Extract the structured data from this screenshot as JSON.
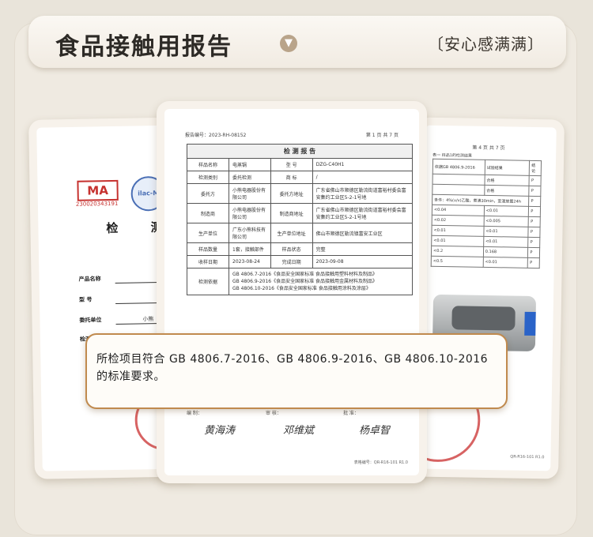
{
  "header": {
    "title": "食品接触用报告",
    "slogan": "〔安心感满满〕"
  },
  "left_cert": {
    "ma_label": "MA",
    "ma_number": "230020343191",
    "ilac_label": "ilac-M",
    "title": "检 测",
    "fields": [
      "产品名称",
      "型 号",
      "委托单位",
      "检测类别"
    ],
    "partial": "小熊"
  },
  "report": {
    "report_no": "报告编号：2023-RH-08152",
    "page": "第 1 页 共 7 页",
    "table_title": "检 测 报 告",
    "rows": [
      {
        "l1": "样品名称",
        "v1": "电蒸锅",
        "l2": "型 号",
        "v2": "DZG-C40H1"
      },
      {
        "l1": "检测类别",
        "v1": "委托检测",
        "l2": "商 标",
        "v2": "/"
      },
      {
        "l1": "委托方",
        "v1": "小熊电器股份有限公司",
        "l2": "委托方地址",
        "v2": "广东省佛山市顺德区勒流街道富裕村委会富安集约工业区5-2-1号地"
      },
      {
        "l1": "制造商",
        "v1": "小熊电器股份有限公司",
        "l2": "制造商地址",
        "v2": "广东省佛山市顺德区勒流街道富裕村委会富安集约工业区5-2-1号地"
      },
      {
        "l1": "生产单位",
        "v1": "广东小熊科技有限公司",
        "l2": "生产单位地址",
        "v2": "佛山市顺德区勒流镇富安工业区"
      },
      {
        "l1": "样品数量",
        "v1": "1套，接触部件",
        "l2": "样品状态",
        "v2": "完整"
      },
      {
        "l1": "收样日期",
        "v1": "2023-08-24",
        "l2": "完成日期",
        "v2": "2023-09-08"
      }
    ],
    "basis_label": "检测依据",
    "basis": [
      "GB 4806.7-2016《食品安全国家标准 食品接触用塑料材料及制品》",
      "GB 4806.9-2016《食品安全国家标准 食品接触用金属材料及制品》",
      "GB 4806.10-2016《食品安全国家标准 食品接触用涂料及涂层》"
    ],
    "sig_labels": [
      "编 制：",
      "审 核：",
      "批 准："
    ],
    "sig_names": [
      "黄海涛",
      "邓维斌",
      "杨卓智"
    ],
    "footer": "表格编号：QR-R16-101 R1.0"
  },
  "right_report": {
    "page": "第 4 页 共 7 页",
    "title": "表一 样品1的检测结果",
    "subtitle": "依据GB 4806.9-2016",
    "cols": [
      "试验结果",
      "结论"
    ],
    "rows": [
      [
        "",
        "合格",
        "P"
      ],
      [
        "",
        "合格",
        "P"
      ],
      [
        "",
        "",
        "P"
      ],
      [
        "<0.04",
        "<0.01",
        "P"
      ],
      [
        "<0.02",
        "<0.005",
        "P"
      ],
      [
        "<0.01",
        "<0.01",
        "P"
      ],
      [
        "<0.01",
        "<0.01",
        "P"
      ],
      [
        "<0.2",
        "0.168",
        "P"
      ],
      [
        "<0.5",
        "<0.01",
        "P"
      ]
    ],
    "note": "条件：4%(v/v)乙酸，煮沸30min，室温放置24h",
    "footer": "QR-R16-101 R1.0"
  },
  "callout": {
    "text": "所检项目符合 GB 4806.7-2016、GB 4806.9-2016、GB 4806.10-2016 的标准要求。"
  }
}
